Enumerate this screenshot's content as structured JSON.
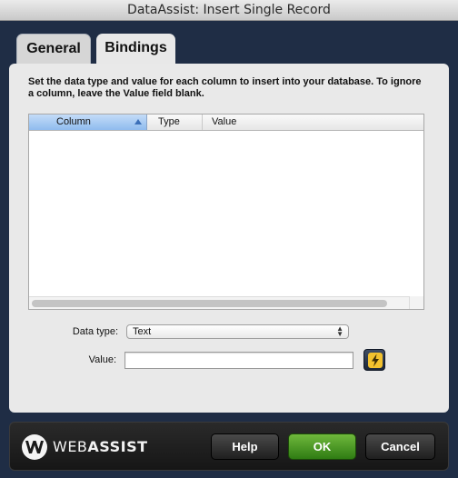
{
  "window": {
    "title": "DataAssist: Insert Single Record"
  },
  "tabs": [
    {
      "label": "General",
      "active": false
    },
    {
      "label": "Bindings",
      "active": true
    }
  ],
  "instructions": "Set the data type and value for each column to insert into your database. To ignore a column, leave the Value field blank.",
  "grid": {
    "columns": [
      "Column",
      "Type",
      "Value"
    ],
    "sorted_column": "Column",
    "rows": []
  },
  "form": {
    "data_type_label": "Data type:",
    "data_type_value": "Text",
    "value_label": "Value:",
    "value": ""
  },
  "footer": {
    "logo_web": "WEB",
    "logo_assist": "ASSIST",
    "help_label": "Help",
    "ok_label": "OK",
    "cancel_label": "Cancel"
  },
  "colors": {
    "background": "#1f2d45",
    "ok_button": "#4a9a24",
    "bolt": "#f2c12e"
  },
  "icons": {
    "bolt": "lightning-bolt-icon",
    "logo": "webassist-logo-icon"
  }
}
